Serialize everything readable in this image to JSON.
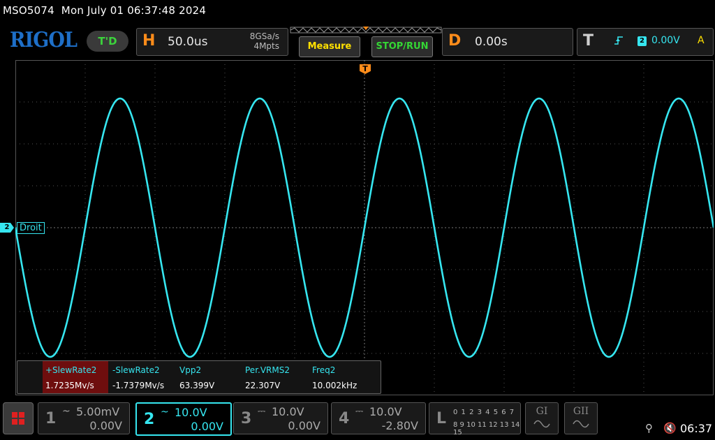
{
  "header": {
    "model": "MSO5074",
    "datetime": "Mon July 01 06:37:48 2024",
    "logo": "RIGOL",
    "td_badge": "T'D"
  },
  "horizontal": {
    "letter": "H",
    "timebase": "50.0us",
    "sample_rate": "8GSa/s",
    "memory_depth": "4Mpts"
  },
  "buttons": {
    "measure": "Measure",
    "stop_run": "STOP/RUN"
  },
  "delay": {
    "letter": "D",
    "value": "0.00s"
  },
  "trigger": {
    "letter": "T",
    "edge_icon": "rising-edge-icon",
    "source": "2",
    "level": "0.00V",
    "mode": "A"
  },
  "waveform": {
    "channel_marker": "2",
    "channel_label": "Droit",
    "trigger_marker": "T",
    "color": "#36e6f0"
  },
  "measurements": [
    {
      "name": "+SlewRate2",
      "value": "1.7235Mv/s",
      "highlighted": true
    },
    {
      "name": "-SlewRate2",
      "value": "-1.7379Mv/s",
      "highlighted": false
    },
    {
      "name": "Vpp2",
      "value": "63.399V",
      "highlighted": false
    },
    {
      "name": "Per.VRMS2",
      "value": "22.307V",
      "highlighted": false
    },
    {
      "name": "Freq2",
      "value": "10.002kHz",
      "highlighted": false
    }
  ],
  "channels": [
    {
      "num": "1",
      "coupling": "~",
      "scale": "5.00mV",
      "offset": "0.00V",
      "active": false
    },
    {
      "num": "2",
      "coupling": "~",
      "scale": "10.0V",
      "offset": "0.00V",
      "active": true
    },
    {
      "num": "3",
      "coupling": "⎓",
      "scale": "10.0V",
      "offset": "0.00V",
      "active": false
    },
    {
      "num": "4",
      "coupling": "⎓",
      "scale": "10.0V",
      "offset": "-2.80V",
      "active": false
    }
  ],
  "logic": {
    "letter": "L",
    "row1": "0 1 2 3  4 5 6 7",
    "row2": "8 9 10 11 12 13 14 15"
  },
  "generators": [
    "GI",
    "GII"
  ],
  "status": {
    "clock": "06:37"
  },
  "colors": {
    "channel2": "#36e6f0",
    "horizontal": "#ff8c1a",
    "measure": "#ffe000",
    "run": "#34d634",
    "highlight": "#6e0e0e"
  }
}
